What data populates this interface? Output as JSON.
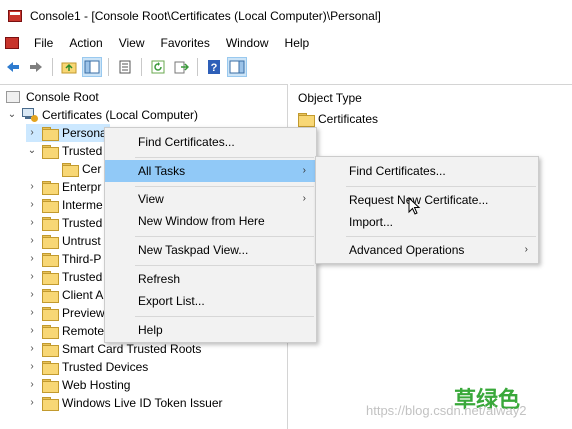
{
  "window": {
    "title": "Console1 - [Console Root\\Certificates (Local Computer)\\Personal]"
  },
  "menubar": {
    "items": [
      "File",
      "Action",
      "View",
      "Favorites",
      "Window",
      "Help"
    ]
  },
  "toolbar": {
    "icons": [
      "back-arrow-icon",
      "forward-arrow-icon",
      "up-folder-icon",
      "show-hide-tree-icon",
      "properties-icon",
      "refresh-icon",
      "export-list-icon",
      "help-icon",
      "show-hide-action-pane-icon"
    ]
  },
  "tree": {
    "root": "Console Root",
    "snapin": "Certificates (Local Computer)",
    "items": [
      "Personal",
      "Trusted Root Certification Authorities",
      "Certificates",
      "Enterprise Trust",
      "Intermediate Certification Authorities",
      "Trusted Publishers",
      "Untrusted Certificates",
      "Third-Party Root Certification Authorities",
      "Trusted People",
      "Client Authentication Issuers",
      "Preview Build Roots",
      "Remote Desktop",
      "Smart Card Trusted Roots",
      "Trusted Devices",
      "Web Hosting",
      "Windows Live ID Token Issuer"
    ],
    "visible_labels": [
      "Persona",
      "Trusted",
      "Cer",
      "Enterpr",
      "Interme",
      "Trusted",
      "Untrust",
      "Third-P",
      "Trusted",
      "Client A",
      "Preview",
      "Remote",
      "Smart Card Trusted Roots",
      "Trusted Devices",
      "Web Hosting",
      "Windows Live ID Token Issuer"
    ]
  },
  "details": {
    "column_header": "Object Type",
    "rows": [
      "Certificates"
    ]
  },
  "context_menu": {
    "items": [
      "Find Certificates...",
      "All Tasks",
      "View",
      "New Window from Here",
      "New Taskpad View...",
      "Refresh",
      "Export List...",
      "Help"
    ]
  },
  "submenu": {
    "items": [
      "Find Certificates...",
      "Request New Certificate...",
      "Import...",
      "Advanced Operations"
    ]
  },
  "watermark": {
    "chinese": "草绿色",
    "url": "https://blog.csdn.net/aiway2"
  },
  "colors": {
    "selection": "#cce8ff",
    "menu_highlight": "#91c9f7",
    "menu_bg": "#f2f2f2",
    "watermark_green": "#39a83a"
  }
}
